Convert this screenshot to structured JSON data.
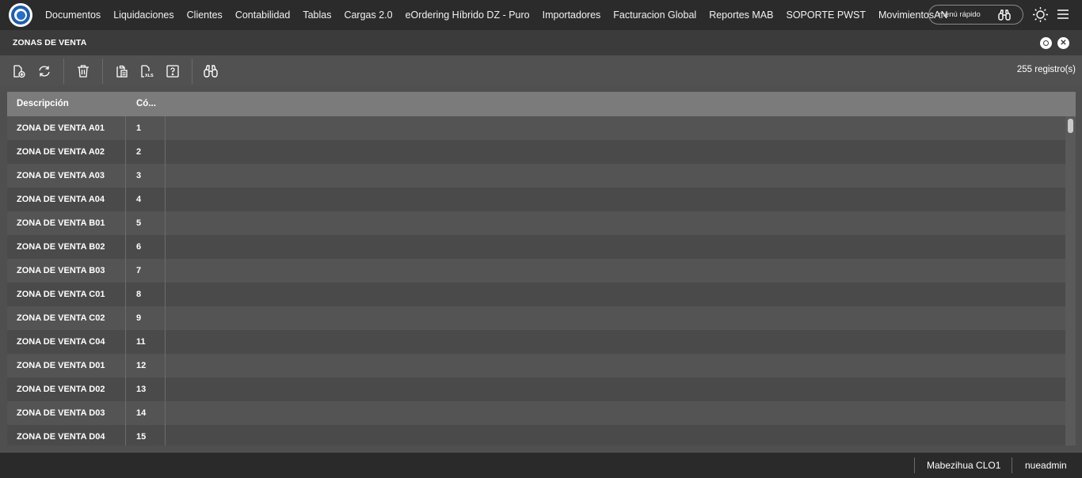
{
  "nav": {
    "items": [
      "Documentos",
      "Liquidaciones",
      "Clientes",
      "Contabilidad",
      "Tablas",
      "Cargas 2.0",
      "eOrdering Híbrido DZ - Puro",
      "Importadores",
      "Facturacion Global",
      "Reportes MAB",
      "SOPORTE PWST",
      "MovimientosAN"
    ],
    "quick_menu_label": "menú rápido"
  },
  "window": {
    "title": "ZONAS DE VENTA"
  },
  "toolbar": {
    "record_count": "255 registro(s)"
  },
  "grid": {
    "columns": [
      "Descripción",
      "Có..."
    ],
    "rows": [
      {
        "desc": "ZONA DE VENTA A01",
        "code": "1"
      },
      {
        "desc": "ZONA DE VENTA A02",
        "code": "2"
      },
      {
        "desc": "ZONA DE VENTA A03",
        "code": "3"
      },
      {
        "desc": "ZONA DE VENTA A04",
        "code": "4"
      },
      {
        "desc": "ZONA DE VENTA B01",
        "code": "5"
      },
      {
        "desc": "ZONA DE VENTA B02",
        "code": "6"
      },
      {
        "desc": "ZONA DE VENTA B03",
        "code": "7"
      },
      {
        "desc": "ZONA DE VENTA C01",
        "code": "8"
      },
      {
        "desc": "ZONA DE VENTA C02",
        "code": "9"
      },
      {
        "desc": "ZONA DE VENTA C04",
        "code": "11"
      },
      {
        "desc": "ZONA DE VENTA D01",
        "code": "12"
      },
      {
        "desc": "ZONA DE VENTA D02",
        "code": "13"
      },
      {
        "desc": "ZONA DE VENTA D03",
        "code": "14"
      },
      {
        "desc": "ZONA DE VENTA D04",
        "code": "15"
      }
    ]
  },
  "status": {
    "company": "Mabezihua CLO1",
    "user": "nueadmin"
  },
  "icons": {
    "logo": "company-logo",
    "quick_menu": "binoculars-icon",
    "theme": "sun-icon",
    "menu": "hamburger-icon",
    "toolbar": [
      "new-document-icon",
      "refresh-icon",
      "delete-icon",
      "copy-clipboard-icon",
      "export-xls-icon",
      "help-icon",
      "search-binoculars-icon"
    ]
  },
  "colors": {
    "nav_bg": "#2b2b2b",
    "title_bg": "#3b3b3b",
    "toolbar_bg": "#515151",
    "header_bg": "#7b7b7b",
    "logo_blue": "#1f5fa8"
  }
}
